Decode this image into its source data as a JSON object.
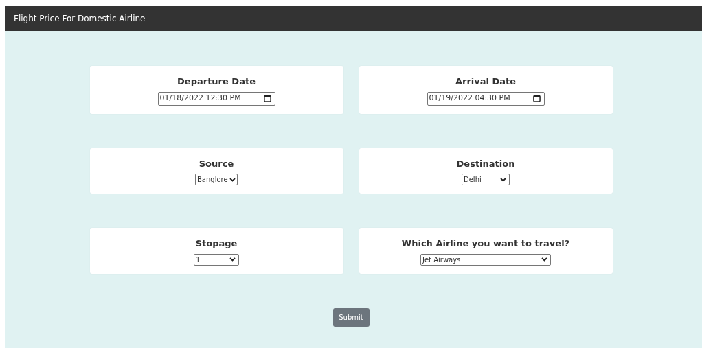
{
  "header": {
    "title": "Flight Price For Domestic Airline"
  },
  "fields": [
    {
      "label": "Departure Date",
      "kind": "datetime",
      "value": "01/18/2022 12:30 PM"
    },
    {
      "label": "Arrival Date",
      "kind": "datetime",
      "value": "01/19/2022 04:30 PM"
    },
    {
      "label": "Source",
      "kind": "select",
      "value": "Banglore"
    },
    {
      "label": "Destination",
      "kind": "select",
      "value": "Delhi"
    },
    {
      "label": "Stopage",
      "kind": "select",
      "value": "1"
    },
    {
      "label": "Which Airline you want to travel?",
      "kind": "select",
      "value": "Jet Airways"
    }
  ],
  "submit": {
    "label": "Submit"
  }
}
